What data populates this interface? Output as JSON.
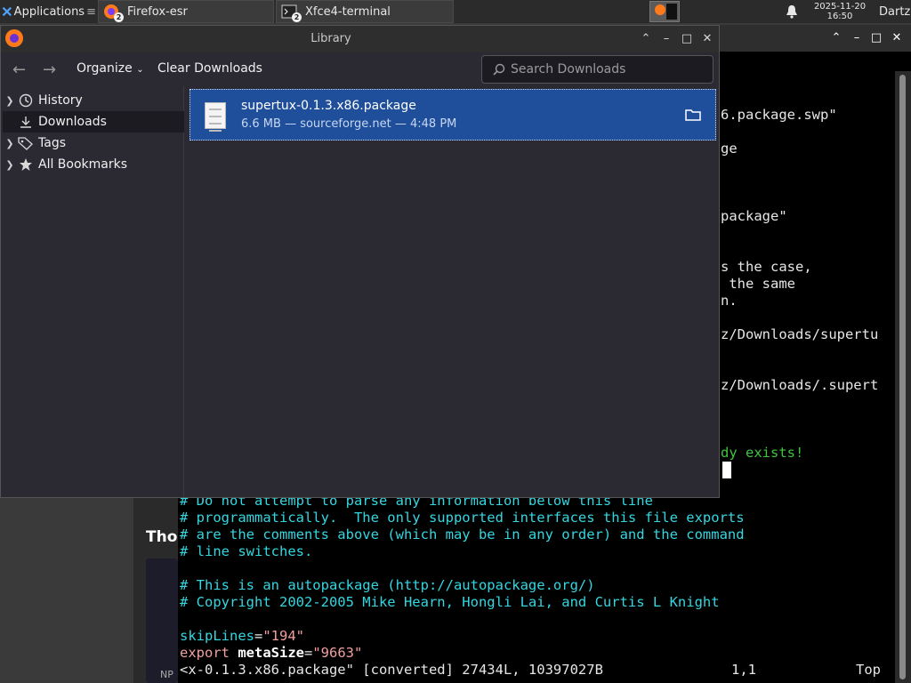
{
  "taskbar": {
    "applications_label": "Applications",
    "firefox_label": "Firefox-esr",
    "firefox_badge": "2",
    "terminal_label": "Xfce4-terminal",
    "terminal_badge": "2",
    "clock_date": "2025-11-20",
    "clock_time": "16:50",
    "user": "Dartz"
  },
  "library": {
    "title": "Library",
    "toolbar": {
      "organize": "Organize",
      "clear_downloads": "Clear Downloads",
      "search_placeholder": "Search Downloads"
    },
    "sidebar": [
      {
        "label": "History",
        "icon": "clock-icon",
        "expandable": true
      },
      {
        "label": "Downloads",
        "icon": "download-icon",
        "expandable": false,
        "selected": true
      },
      {
        "label": "Tags",
        "icon": "tag-icon",
        "expandable": true
      },
      {
        "label": "All Bookmarks",
        "icon": "star-icon",
        "expandable": true
      }
    ],
    "downloads": [
      {
        "name": "supertux-0.1.3.x86.package",
        "meta": "6.6 MB — sourceforge.net — 4:48 PM"
      }
    ]
  },
  "terminal": {
    "upper_lines": [
      {
        "text": "6.package.swp\"",
        "color": "white"
      },
      {
        "text": "ge",
        "color": "white"
      },
      {
        "text": "package\"",
        "color": "white"
      },
      {
        "text": "s the case,",
        "color": "white"
      },
      {
        "text": " the same",
        "color": "white"
      },
      {
        "text": "n.",
        "color": "white"
      },
      {
        "text": "z/Downloads/supertu",
        "color": "white"
      },
      {
        "text": "z/Downloads/.supert",
        "color": "white"
      },
      {
        "text": "dy exists!",
        "color": "green"
      }
    ],
    "lower_lines": [
      "# Do not attempt to parse any information below this line",
      "# programmatically.  The only supported interfaces this file exports",
      "# are the comments above (which may be in any order) and the command",
      "# line switches.",
      "",
      "# This is an autopackage (http://autopackage.org/)",
      "# Copyright 2002-2005 Mike Hearn, Hongli Lai, and Curtis L Knight"
    ],
    "skiplines_key": "skipLines",
    "skiplines_eq": "=",
    "skiplines_val": "\"194\"",
    "export_kw": "export",
    "metasize_key": "metaSize",
    "metasize_eq": "=",
    "metasize_val": "\"9663\"",
    "status_file": "<x-0.1.3.x86.package\" [converted] 27434L, 10397027B",
    "status_pos": "1,1",
    "status_scroll": "Top"
  },
  "background_page": {
    "heading": "Tho",
    "np": "NP"
  },
  "colors": {
    "selection": "#1f4f9b",
    "terminal_cyan": "#34d6e0",
    "terminal_green": "#3fc43f"
  }
}
